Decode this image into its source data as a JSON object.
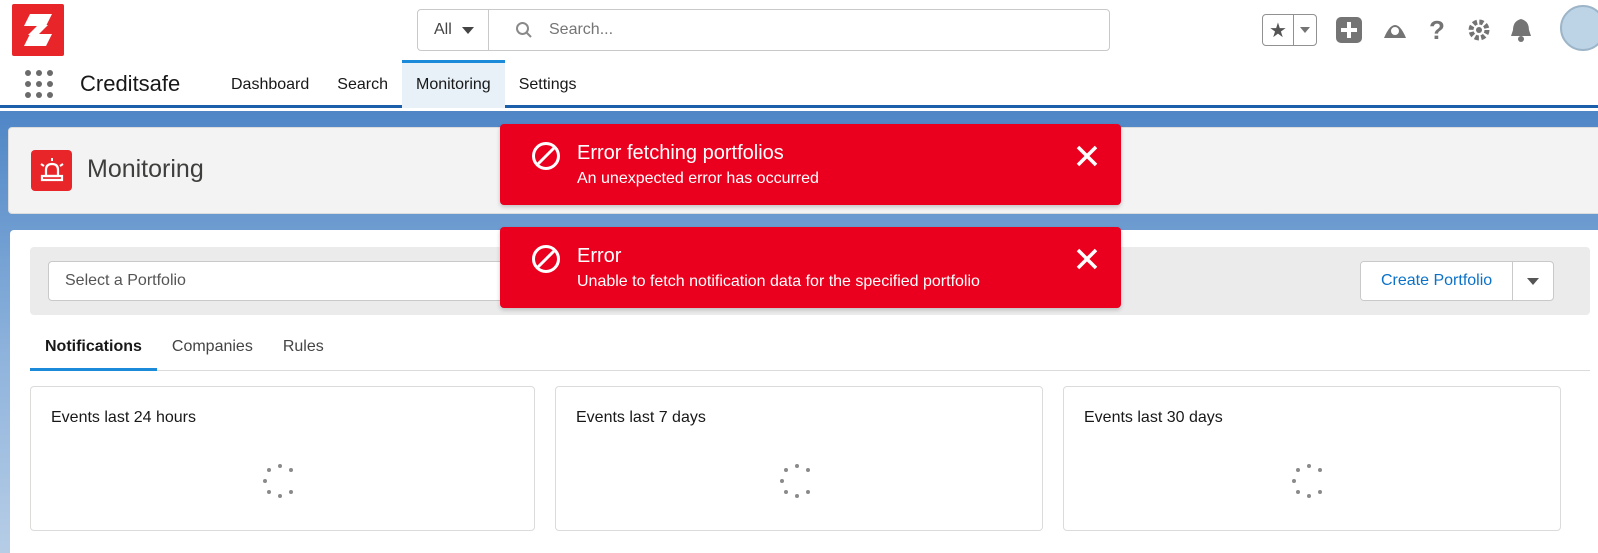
{
  "header": {
    "search_scope": "All",
    "search_placeholder": "Search...",
    "icons": [
      "favorites-star-icon",
      "add-icon",
      "trailhead-icon",
      "help-icon",
      "setup-gear-icon",
      "notifications-bell-icon",
      "user-avatar"
    ]
  },
  "nav": {
    "app_name": "Creditsafe",
    "tabs": [
      {
        "label": "Dashboard",
        "active": false
      },
      {
        "label": "Search",
        "active": false
      },
      {
        "label": "Monitoring",
        "active": true
      },
      {
        "label": "Settings",
        "active": false
      }
    ]
  },
  "page": {
    "title": "Monitoring"
  },
  "portfolio": {
    "select_placeholder": "Select a Portfolio",
    "create_label": "Create Portfolio"
  },
  "tabs": [
    {
      "label": "Notifications",
      "active": true
    },
    {
      "label": "Companies",
      "active": false
    },
    {
      "label": "Rules",
      "active": false
    }
  ],
  "cards": [
    {
      "title": "Events last 24 hours"
    },
    {
      "title": "Events last 7 days"
    },
    {
      "title": "Events last 30 days"
    }
  ],
  "toasts": [
    {
      "title": "Error fetching portfolios",
      "message": "An unexpected error has occurred"
    },
    {
      "title": "Error",
      "message": "Unable to fetch notification data for the specified portfolio"
    }
  ],
  "colors": {
    "brand": "#e8262a",
    "error": "#ea001e",
    "accent": "#1b8ad8",
    "link": "#0b72c7"
  }
}
